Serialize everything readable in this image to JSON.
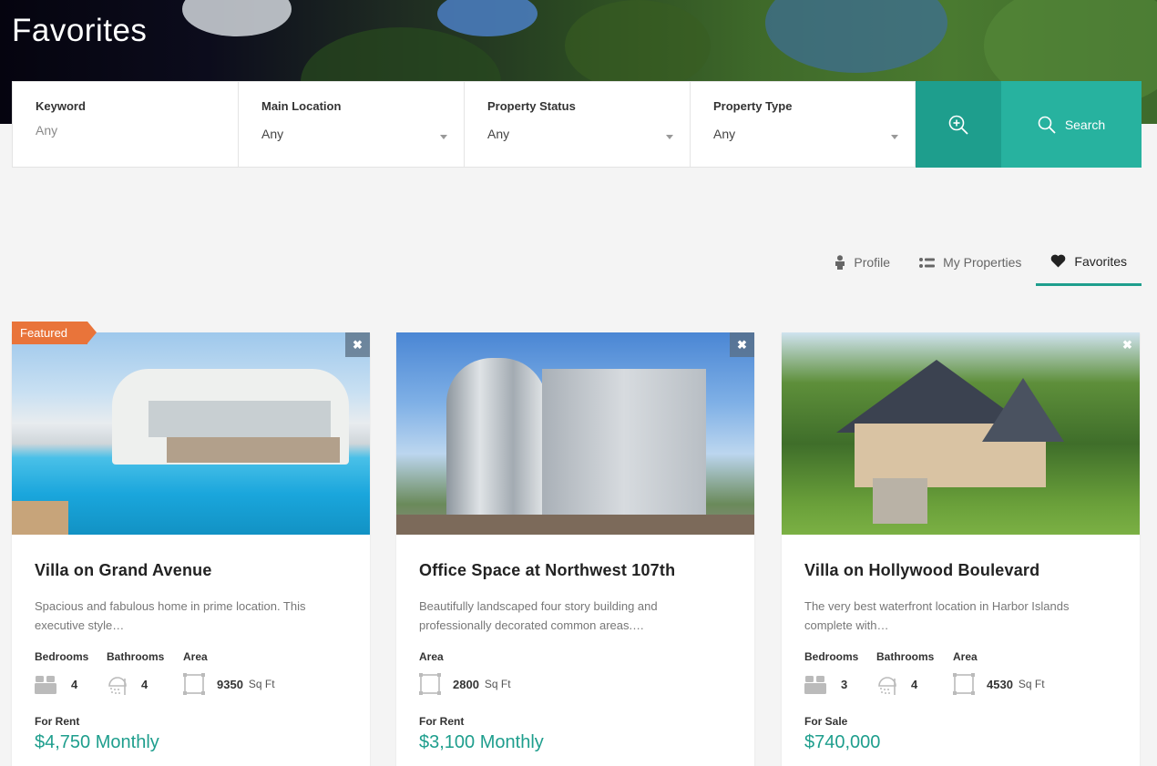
{
  "page": {
    "title": "Favorites"
  },
  "colors": {
    "accent": "#1e9e8d",
    "accent_light": "#27b29f",
    "featured": "#e9743a"
  },
  "search": {
    "fields": [
      {
        "label": "Keyword",
        "value": "Any"
      },
      {
        "label": "Main Location",
        "value": "Any"
      },
      {
        "label": "Property Status",
        "value": "Any"
      },
      {
        "label": "Property Type",
        "value": "Any"
      }
    ],
    "search_label": "Search"
  },
  "tabs": [
    {
      "label": "Profile",
      "icon": "person-icon"
    },
    {
      "label": "My Properties",
      "icon": "list-icon"
    },
    {
      "label": "Favorites",
      "icon": "heart-icon",
      "active": true
    }
  ],
  "badge": "Featured",
  "remove_symbol": "✖",
  "cards": [
    {
      "title": "Villa on Grand Avenue",
      "description": "Spacious and fabulous home in prime location. This executive style…",
      "labels": {
        "bedrooms": "Bedrooms",
        "bathrooms": "Bathrooms",
        "area": "Area"
      },
      "bedrooms": "4",
      "bathrooms": "4",
      "area": "9350",
      "area_unit": "Sq Ft",
      "status": "For Rent",
      "price": "$4,750 Monthly"
    },
    {
      "title": "Office Space at Northwest 107th",
      "description": "Beautifully landscaped four story building and professionally decorated common areas.…",
      "labels": {
        "area": "Area"
      },
      "area": "2800",
      "area_unit": "Sq Ft",
      "status": "For Rent",
      "price": "$3,100 Monthly"
    },
    {
      "title": "Villa on Hollywood Boulevard",
      "description": "The very best waterfront location in Harbor Islands complete with…",
      "labels": {
        "bedrooms": "Bedrooms",
        "bathrooms": "Bathrooms",
        "area": "Area"
      },
      "bedrooms": "3",
      "bathrooms": "4",
      "area": "4530",
      "area_unit": "Sq Ft",
      "status": "For Sale",
      "price": "$740,000"
    }
  ]
}
